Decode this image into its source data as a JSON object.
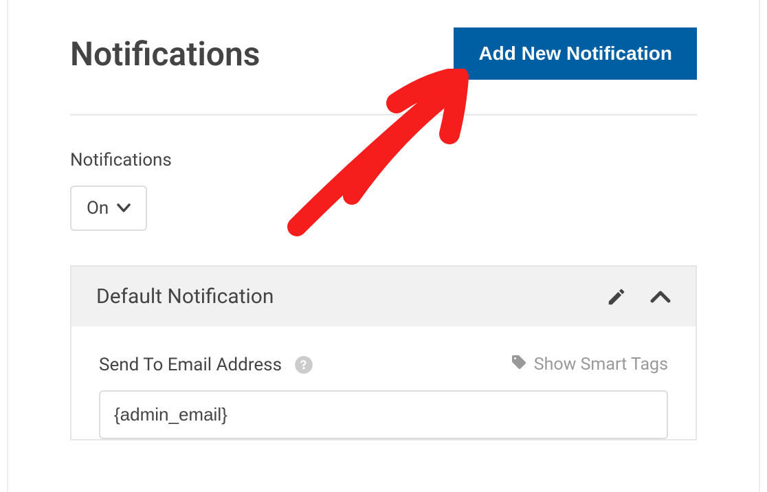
{
  "header": {
    "title": "Notifications",
    "add_button": "Add New Notification"
  },
  "toggle": {
    "label": "Notifications",
    "value": "On"
  },
  "panel": {
    "title": "Default Notification",
    "field_label": "Send To Email Address",
    "smart_tags_label": "Show Smart Tags",
    "email_value": "{admin_email}"
  }
}
